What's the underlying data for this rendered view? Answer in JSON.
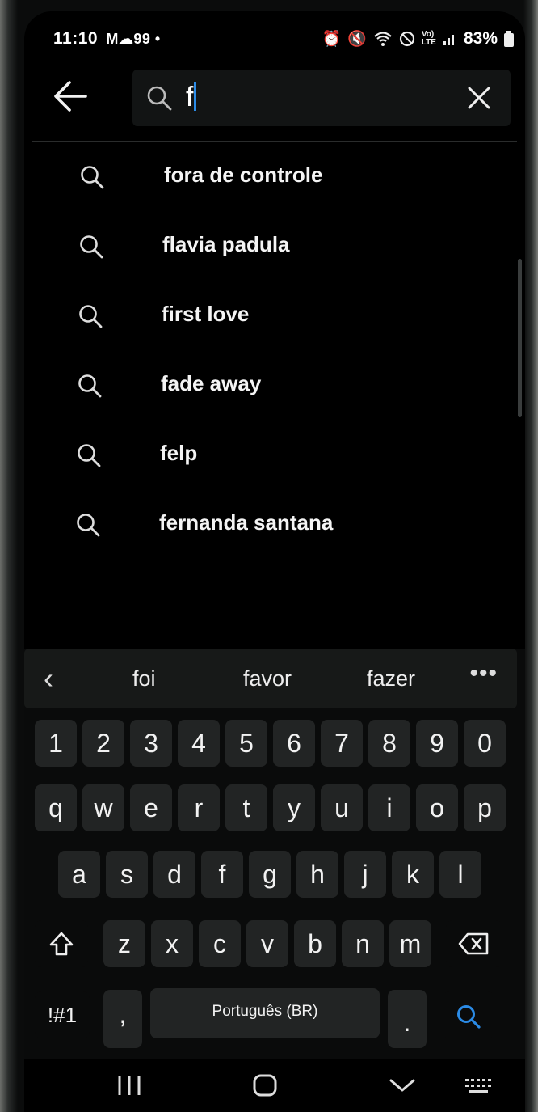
{
  "status_bar": {
    "time": "11:10",
    "notif_icons": "M☁︎99 •",
    "battery": "83%"
  },
  "search": {
    "query": "f"
  },
  "suggestions": [
    {
      "label": "fora de controle"
    },
    {
      "label": "flavia padula"
    },
    {
      "label": "first love"
    },
    {
      "label": "fade away"
    },
    {
      "label": "felp"
    },
    {
      "label": "fernanda santana"
    }
  ],
  "keyboard": {
    "predictions": [
      "foi",
      "favor",
      "fazer"
    ],
    "number_row": [
      "1",
      "2",
      "3",
      "4",
      "5",
      "6",
      "7",
      "8",
      "9",
      "0"
    ],
    "row1": [
      "q",
      "w",
      "e",
      "r",
      "t",
      "y",
      "u",
      "i",
      "o",
      "p"
    ],
    "row2": [
      "a",
      "s",
      "d",
      "f",
      "g",
      "h",
      "j",
      "k",
      "l"
    ],
    "row3": [
      "z",
      "x",
      "c",
      "v",
      "b",
      "n",
      "m"
    ],
    "symbols_key": "!#1",
    "comma_key": ",",
    "space_label": "Português (BR)",
    "period_key": ".",
    "accent_color": "#2b8be6"
  },
  "icons": {
    "back": "arrow-left-icon",
    "search": "search-icon",
    "clear": "close-icon",
    "shift": "shift-icon",
    "backspace": "backspace-icon",
    "nav_recents": "recents-icon",
    "nav_home": "home-icon",
    "nav_back": "chevron-down-icon",
    "nav_keyboard": "keyboard-icon"
  }
}
